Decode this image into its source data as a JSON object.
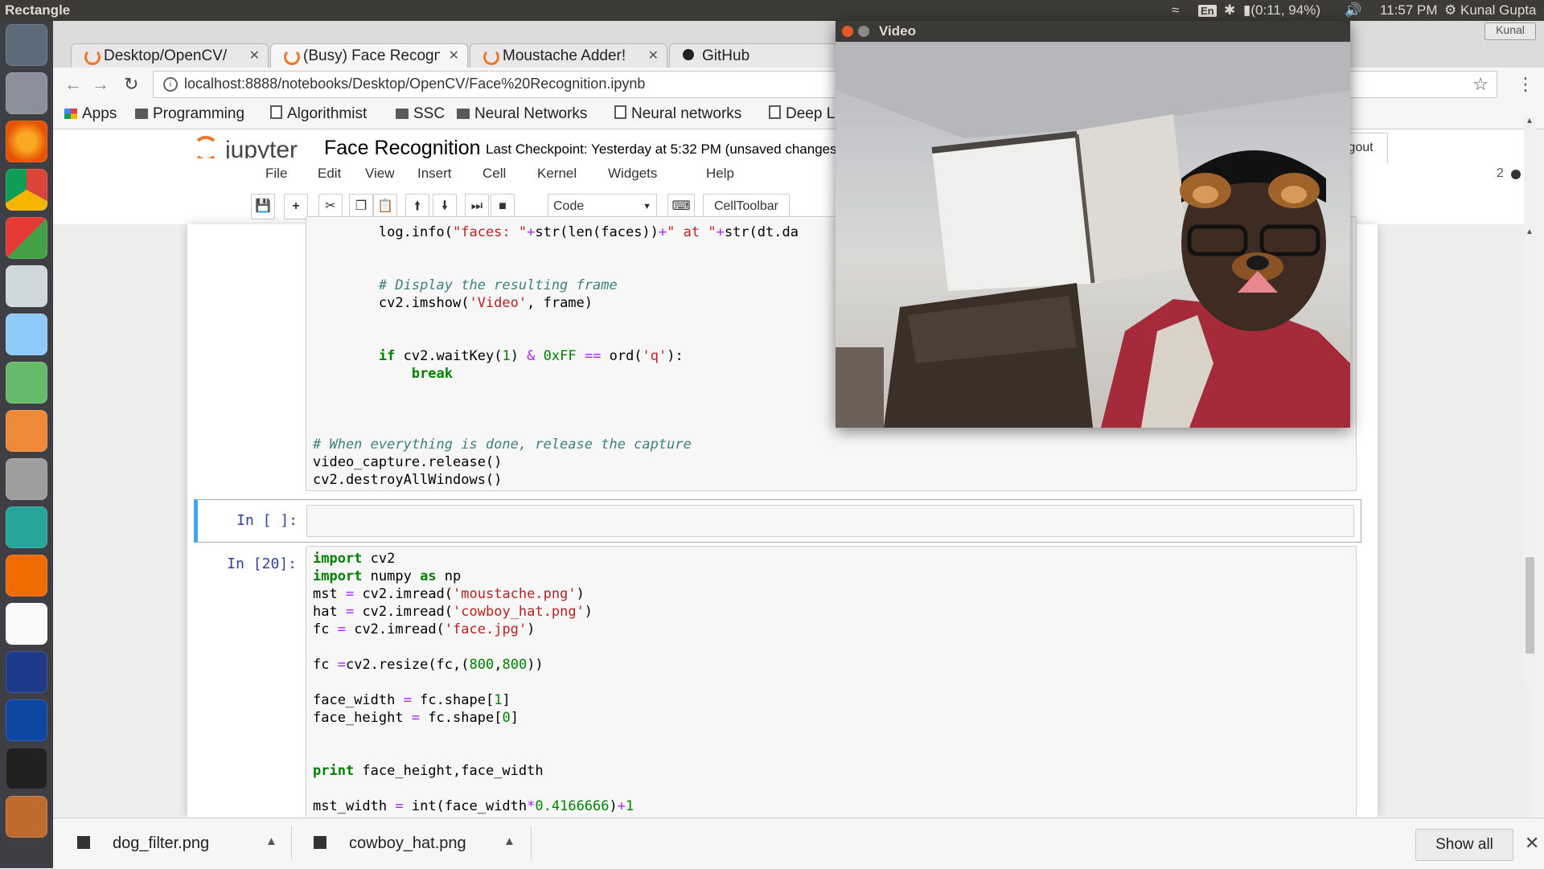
{
  "os": {
    "active_app": "Rectangle",
    "indicators": {
      "keyboard": "En",
      "battery": "(0:11, 94%)",
      "clock": "11:57 PM",
      "user": "Kunal Gupta",
      "ws_label": "Kunal"
    }
  },
  "tabs": [
    {
      "label": "Desktop/OpenCV/"
    },
    {
      "label": "(Busy) Face Recogn"
    },
    {
      "label": "Moustache Adder!"
    },
    {
      "label": "GitHub"
    }
  ],
  "omnibox": {
    "url": "localhost:8888/notebooks/Desktop/OpenCV/Face%20Recognition.ipynb"
  },
  "bookmarks": [
    {
      "label": "Apps"
    },
    {
      "label": "Programming"
    },
    {
      "label": "Algorithmist"
    },
    {
      "label": "SSC"
    },
    {
      "label": "Neural Networks"
    },
    {
      "label": "Neural networks"
    },
    {
      "label": "Deep L"
    }
  ],
  "jupyter": {
    "logo_text": "jupyter",
    "notebook_title": "Face Recognition",
    "checkpoint": "Last Checkpoint: Yesterday at 5:32 PM (unsaved changes",
    "logout_label": "gout",
    "kernel_indicator": "2",
    "menu": [
      "File",
      "Edit",
      "View",
      "Insert",
      "Cell",
      "Kernel",
      "Widgets",
      "Help"
    ],
    "cell_type": "Code",
    "celltoolbar_label": "CellToolbar"
  },
  "cells": {
    "prompt_empty": "In [ ]:",
    "prompt_20": "In [20]:"
  },
  "downloads": [
    {
      "name": "dog_filter.png"
    },
    {
      "name": "cowboy_hat.png"
    }
  ],
  "shelf": {
    "show_all": "Show all"
  },
  "video_window": {
    "title": "Video"
  }
}
